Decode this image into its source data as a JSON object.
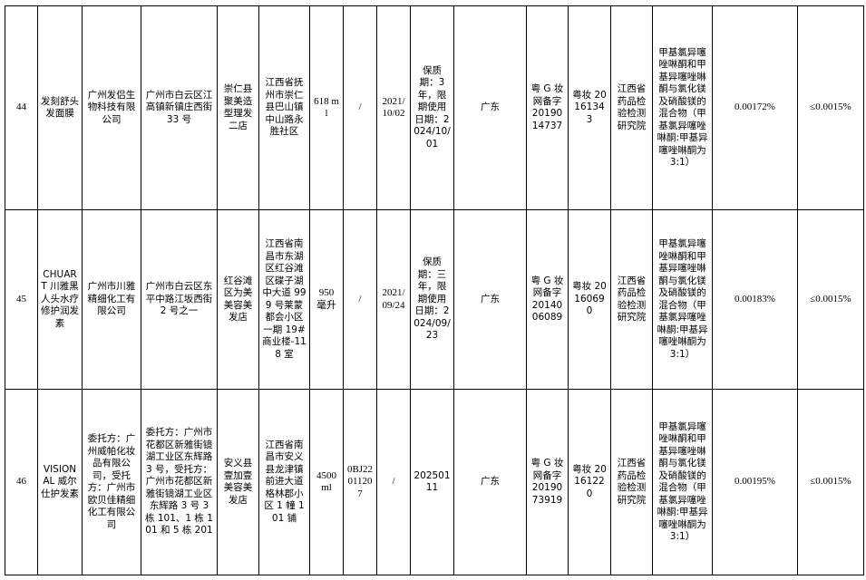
{
  "table": {
    "rows": [
      {
        "no": "44",
        "product_name": "发刻舒头发面膜",
        "manufacturer": "广州发侣生物科技有限公司",
        "manufacturer_address": "广州市白云区江高镇新镇庄西街 33 号",
        "sampled_unit": "崇仁县聚美造型理发二店",
        "sampled_unit_address": "江西省抚州市崇仁县巴山镇中山路永胜社区",
        "spec": "618 ml",
        "batch": "/",
        "production_date": "2021/10/02",
        "expiry": "保质期：3 年，限期使用日期：2024/10/01",
        "province": "广东",
        "filing_no": "粤 G 妆网备字 2019014737",
        "license_no": "粤妆 20161343",
        "test_institution": "江西省药品检验检测研究院",
        "item": "甲基氯异噻唑啉酮和甲基异噻唑啉酮与氯化镁及硝酸镁的混合物（甲基氯异噻唑啉酮:甲基异噻唑啉酮为 3:1）",
        "result": "0.00172%",
        "standard": "≤0.0015%"
      },
      {
        "no": "45",
        "product_name": "CHUART 川雅黑人头水疗修护润发素",
        "manufacturer": "广州市川雅精细化工有限公司",
        "manufacturer_address": "广州市白云区东平中路江坂西街 2 号之一",
        "sampled_unit": "红谷滩区为美美容美发店",
        "sampled_unit_address": "江西省南昌市东湖区红谷滩区碟子湖中大道 999 号莱蒙都会小区一期 19#商业楼-118 室",
        "spec": "950 毫升",
        "batch": "/",
        "production_date": "2021/09/24",
        "expiry": "保质期：三年，限期使用日期：2024/09/23",
        "province": "广东",
        "filing_no": "粤 G 妆网备字 2014006089",
        "license_no": "粤妆 20160690",
        "test_institution": "江西省药品检验检测研究院",
        "item": "甲基氯异噻唑啉酮和甲基异噻唑啉酮与氯化镁及硝酸镁的混合物（甲基氯异噻唑啉酮:甲基异噻唑啉酮为 3:1）",
        "result": "0.00183%",
        "standard": "≤0.0015%"
      },
      {
        "no": "46",
        "product_name": "VISIONAL 威尔仕护发素",
        "manufacturer": "委托方：广州威帕化妆品有限公司，受托方：广州市欧贝佳精细化工有限公司",
        "manufacturer_address": "委托方：广州市花都区新雅街镜湖工业区东辉路 3 号，受托方：广州市花都区新雅街镜湖工业区东辉路 3 号 3 栋 101、1 栋 101 和 5 栋 201",
        "sampled_unit": "安义县壹加壹美容美发店",
        "sampled_unit_address": "江西省南昌市安义县龙津镇前进大道格林郡小区 1 幢 101 铺",
        "spec": "4500 ml",
        "batch": "0BJ22011207",
        "production_date": "/",
        "expiry": "20250111",
        "province": "广东",
        "filing_no": "粤 G 妆网备字 2019073919",
        "license_no": "粤妆 20161220",
        "test_institution": "江西省药品检验检测研究院",
        "item": "甲基氯异噻唑啉酮和甲基异噻唑啉酮与氯化镁及硝酸镁的混合物（甲基氯异噻唑啉酮:甲基异噻唑啉酮为 3:1）",
        "result": "0.00195%",
        "standard": "≤0.0015%"
      }
    ]
  }
}
